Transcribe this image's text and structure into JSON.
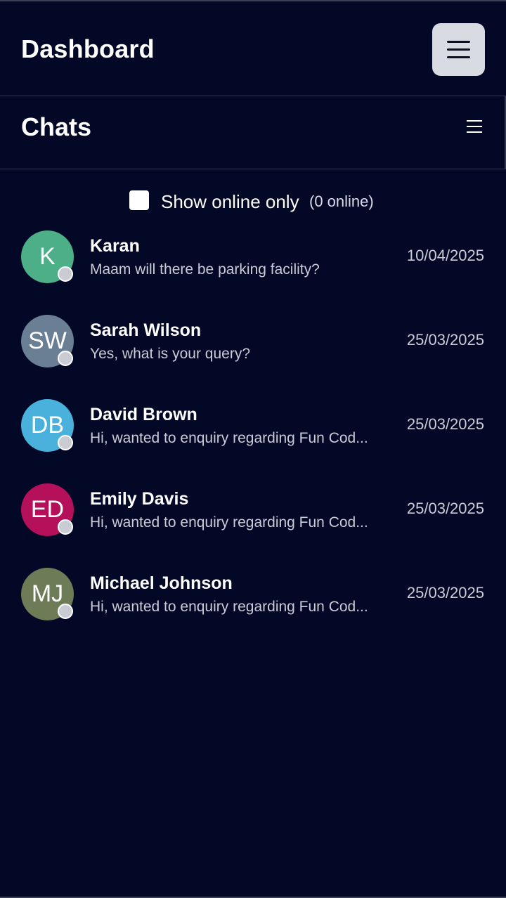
{
  "header": {
    "title": "Dashboard",
    "menu_icon": "hamburger-icon"
  },
  "chats_panel": {
    "title": "Chats",
    "list_icon": "list-icon",
    "filter": {
      "label": "Show online only",
      "checked": false,
      "online_count_text": "(0 online)"
    },
    "items": [
      {
        "initials": "K",
        "name": "Karan",
        "preview": "Maam will there be parking facility?",
        "date": "10/04/2025",
        "avatar_color": "#4caf87"
      },
      {
        "initials": "SW",
        "name": "Sarah Wilson",
        "preview": "Yes, what is your query?",
        "date": "25/03/2025",
        "avatar_color": "#6b7f94"
      },
      {
        "initials": "DB",
        "name": "David Brown",
        "preview": "Hi, wanted to enquiry regarding Fun Cod...",
        "date": "25/03/2025",
        "avatar_color": "#4ab0dc"
      },
      {
        "initials": "ED",
        "name": "Emily Davis",
        "preview": "Hi, wanted to enquiry regarding Fun Cod...",
        "date": "25/03/2025",
        "avatar_color": "#b5105a"
      },
      {
        "initials": "MJ",
        "name": "Michael Johnson",
        "preview": "Hi, wanted to enquiry regarding Fun Cod...",
        "date": "25/03/2025",
        "avatar_color": "#6d7c57"
      }
    ]
  }
}
